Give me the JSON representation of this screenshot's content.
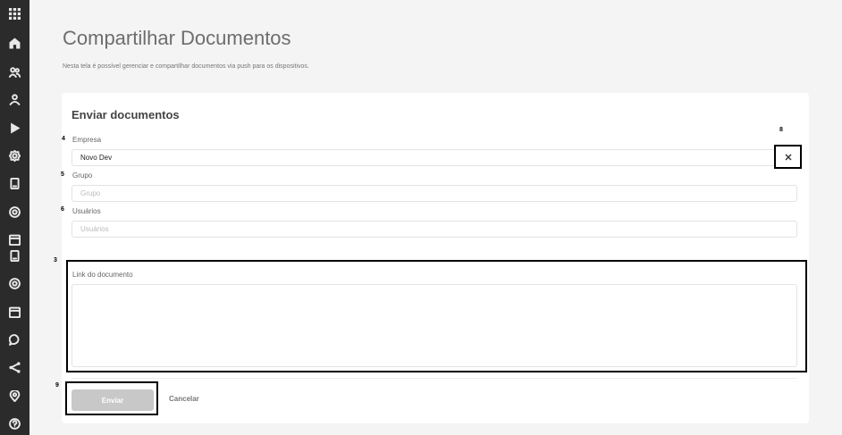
{
  "header": {
    "title": "Compartilhar Documentos",
    "description": "Nesta tela é possível gerenciar e compartilhar documentos via push para os dispositivos."
  },
  "sidebar": {
    "items": [
      {
        "icon": "apps-grid-icon"
      },
      {
        "icon": "dashboard-icon"
      },
      {
        "icon": "users-icon"
      },
      {
        "icon": "user-icon"
      },
      {
        "icon": "play-icon"
      },
      {
        "icon": "settings-icon"
      },
      {
        "icon": "device-icon"
      },
      {
        "icon": "target-icon"
      },
      {
        "icon": "calendar-icon"
      },
      {
        "icon": "device-icon"
      },
      {
        "icon": "target-icon"
      },
      {
        "icon": "calendar-icon"
      },
      {
        "icon": "chat-icon"
      },
      {
        "icon": "share-icon"
      },
      {
        "icon": "location-icon"
      },
      {
        "icon": "help-icon"
      }
    ]
  },
  "form": {
    "section_title": "Enviar documentos",
    "empresa": {
      "marker": "4",
      "label": "Empresa",
      "value": "Novo Dev"
    },
    "grupo": {
      "marker": "5",
      "label": "Grupo",
      "placeholder": "Grupo"
    },
    "usuarios": {
      "marker": "6",
      "label": "Usuários",
      "placeholder": "Usuários"
    },
    "clear": {
      "marker": "8",
      "symbol": "×"
    },
    "link": {
      "marker": "3",
      "label": "Link do documento",
      "value": ""
    },
    "send": {
      "marker": "9",
      "label": "Enviar"
    },
    "cancel_label": "Cancelar"
  },
  "colors": {
    "sidebar_bg": "#2b2b2b",
    "page_bg": "#f4f4f4",
    "button_disabled": "#c8c8c8"
  }
}
